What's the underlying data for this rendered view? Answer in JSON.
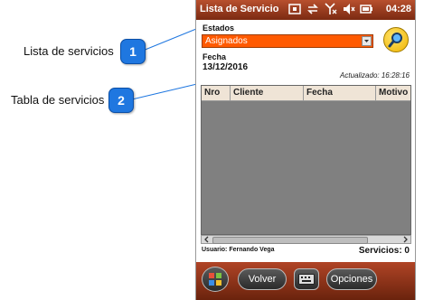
{
  "callouts": [
    {
      "number": "1",
      "label": "Lista de servicios"
    },
    {
      "number": "2",
      "label": "Tabla de servicios"
    }
  ],
  "statusbar": {
    "title": "Lista de Servicio",
    "time": "04:28",
    "icons": [
      "window-icon",
      "sync-icon",
      "no-signal-icon",
      "speaker-mute-icon",
      "battery-icon"
    ]
  },
  "form": {
    "estados_label": "Estados",
    "estados_value": "Asignados",
    "fecha_label": "Fecha",
    "fecha_value": "13/12/2016",
    "updated_text": "Actualizado: 16:28:16"
  },
  "table": {
    "columns": [
      "Nro",
      "Cliente",
      "Fecha",
      "Motivo"
    ],
    "rows": []
  },
  "footer": {
    "user_text": "Usuario: Fernando Vega",
    "services_text": "Servicios: 0"
  },
  "toolbar": {
    "volver_label": "Volver",
    "opciones_label": "Opciones"
  },
  "colors": {
    "accent": "#ff5a00",
    "bar": "#8b3217",
    "callout": "#1f77e0",
    "grid": "#808080"
  }
}
